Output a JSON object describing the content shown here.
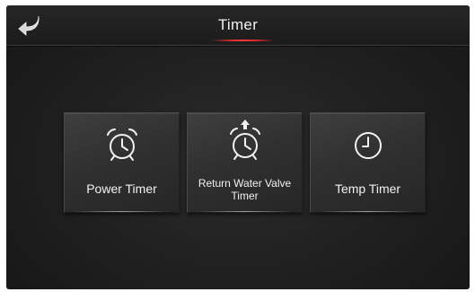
{
  "header": {
    "title": "Timer",
    "back_icon": "back-arrow-icon"
  },
  "tiles": [
    {
      "label": "Power Timer",
      "icon": "alarm-clock-icon"
    },
    {
      "label": "Return Water Valve Timer",
      "icon": "alarm-clock-up-arrow-icon"
    },
    {
      "label": "Temp Timer",
      "icon": "clock-icon"
    }
  ],
  "colors": {
    "accent": "#d22a2a",
    "background": "#1f1f1f",
    "text": "#f0f0f0"
  }
}
